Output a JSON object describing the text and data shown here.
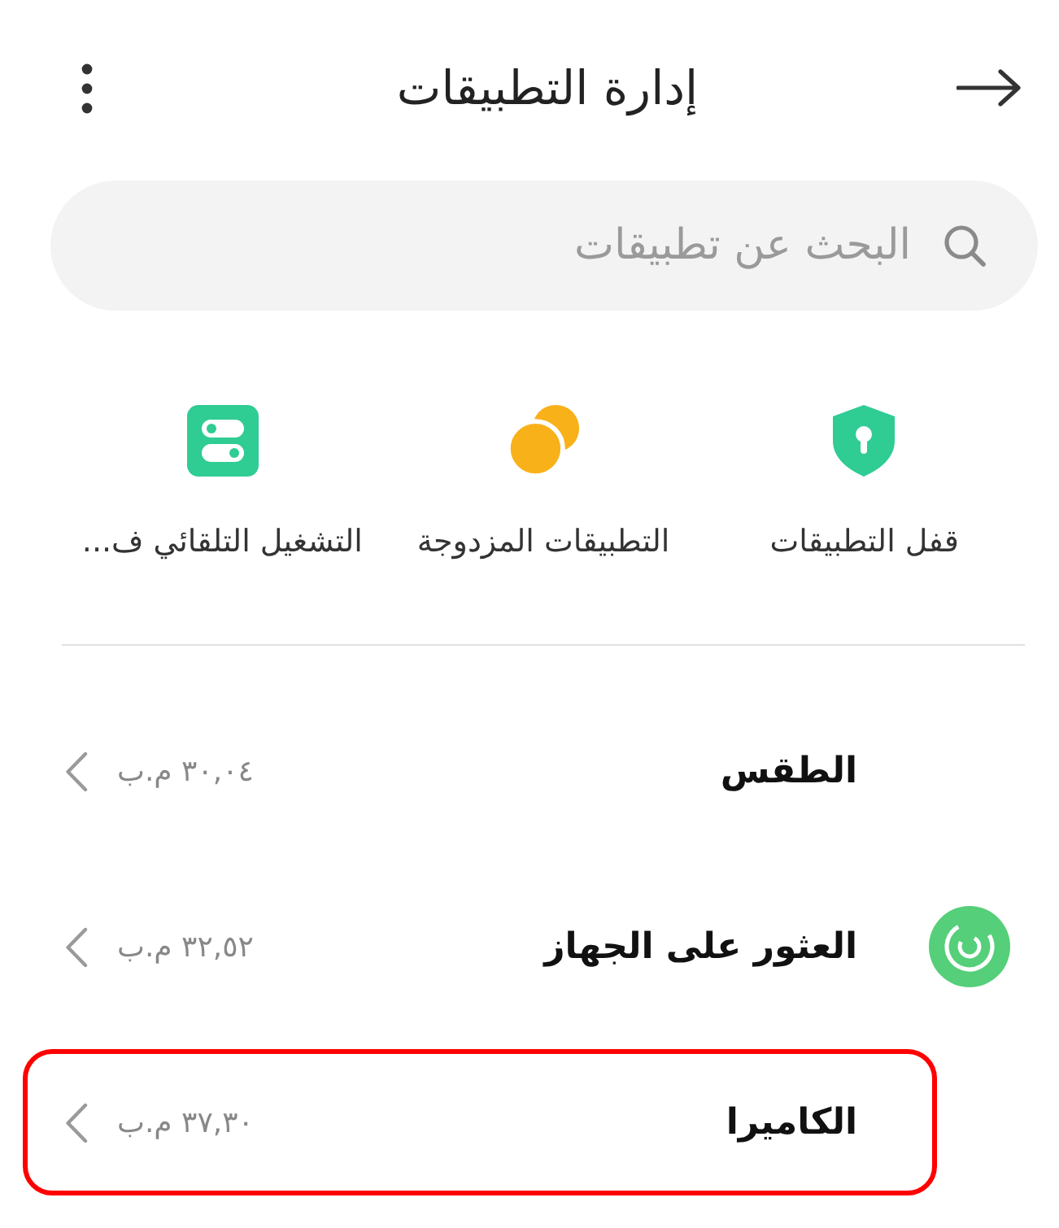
{
  "header": {
    "title": "إدارة التطبيقات"
  },
  "search": {
    "placeholder": "البحث عن تطبيقات"
  },
  "shortcuts": [
    {
      "kind": "lock",
      "label": "قفل التطبيقات"
    },
    {
      "kind": "dual",
      "label": "التطبيقات المزدوجة"
    },
    {
      "kind": "autostart",
      "label": "التشغيل التلقائي ف..."
    }
  ],
  "apps": [
    {
      "name": "الطقس",
      "size": "٣٠,٠٤ م.ب",
      "has_icon": false,
      "highlighted": false
    },
    {
      "name": "العثور على الجهاز",
      "size": "٣٢,٥٢ م.ب",
      "has_icon": true,
      "highlighted": false
    },
    {
      "name": "الكاميرا",
      "size": "٣٧,٣٠ م.ب",
      "has_icon": false,
      "highlighted": true
    }
  ]
}
